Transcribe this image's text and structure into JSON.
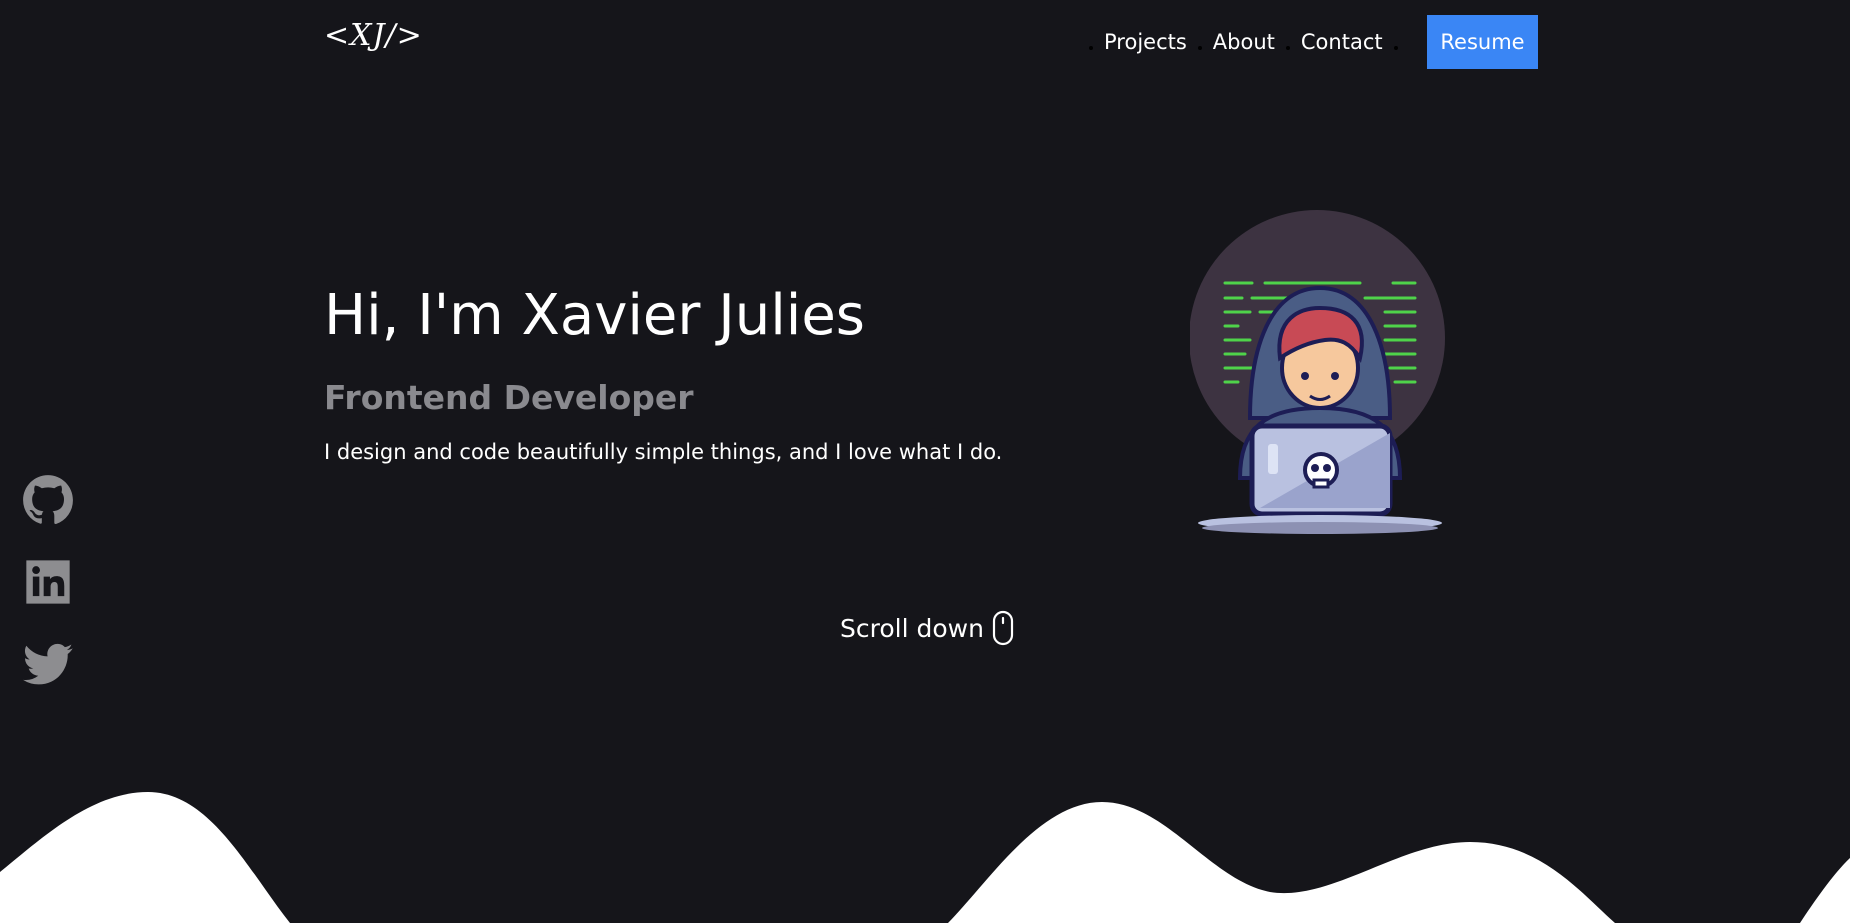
{
  "header": {
    "logo_text": "<XJ/>",
    "nav": [
      {
        "label": "Projects"
      },
      {
        "label": "About"
      },
      {
        "label": "Contact"
      }
    ],
    "resume_label": "Resume"
  },
  "hero": {
    "title": "Hi, I'm Xavier Julies",
    "role": "Frontend Developer",
    "description": "I design and code beautifully simple things, and I love what I do.",
    "illustration_icon": "developer-with-laptop-illustration"
  },
  "social": [
    {
      "icon": "github-icon"
    },
    {
      "icon": "linkedin-icon"
    },
    {
      "icon": "twitter-icon"
    }
  ],
  "scroll": {
    "label": "Scroll down",
    "icon": "mouse-icon"
  },
  "colors": {
    "background": "#15151a",
    "accent": "#3a86f5",
    "muted": "#8a8a8f",
    "social_icon": "#8d8d90",
    "wave": "#ffffff",
    "code_lines": "#4fd34a"
  }
}
